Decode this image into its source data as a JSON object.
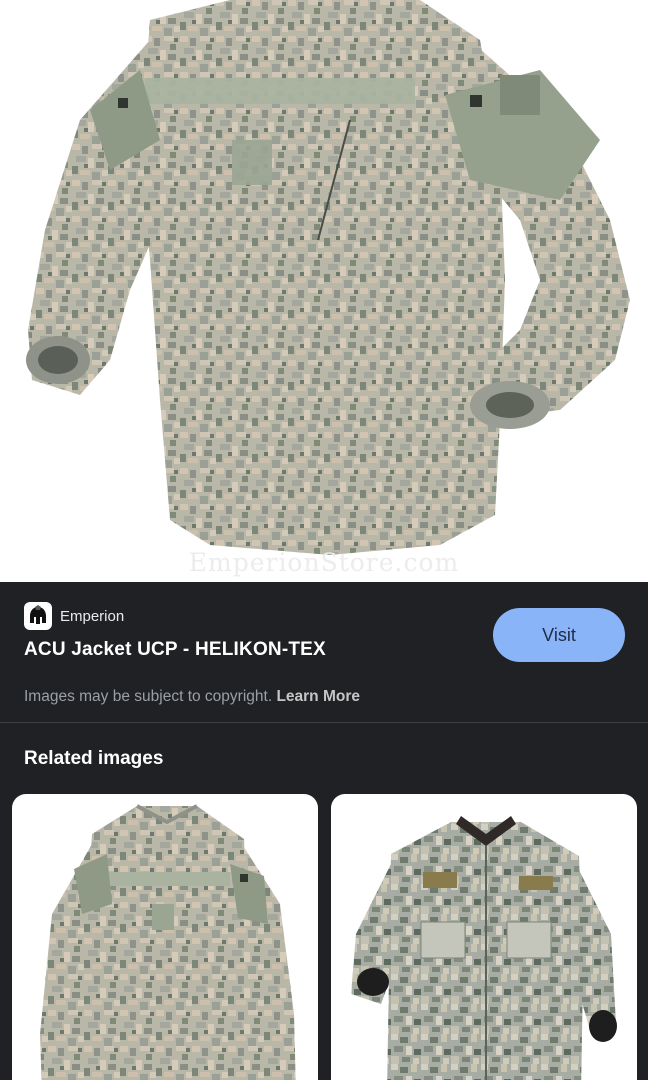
{
  "hero_image": {
    "alt_subject": "ACU Jacket UCP camouflage",
    "watermark": "EmperionStore.com"
  },
  "result": {
    "source_name": "Emperion",
    "source_icon": "spartan-helmet-icon",
    "title": "ACU Jacket UCP - HELIKON-TEX",
    "visit_label": "Visit",
    "copyright_text": "Images may be subject to copyright.",
    "learn_more_label": "Learn More"
  },
  "related": {
    "heading": "Related images",
    "items": [
      {
        "subject": "ACU jacket UCP camo (light)"
      },
      {
        "subject": "ACU jacket UCP camo (dark)"
      }
    ]
  },
  "colors": {
    "panel_bg": "#202124",
    "visit_button": "#8ab4f8",
    "camo_base": "#b8b6a6",
    "camo_tan": "#cfc2b0",
    "camo_grey": "#8f938a",
    "camo_green": "#7b8a73"
  }
}
